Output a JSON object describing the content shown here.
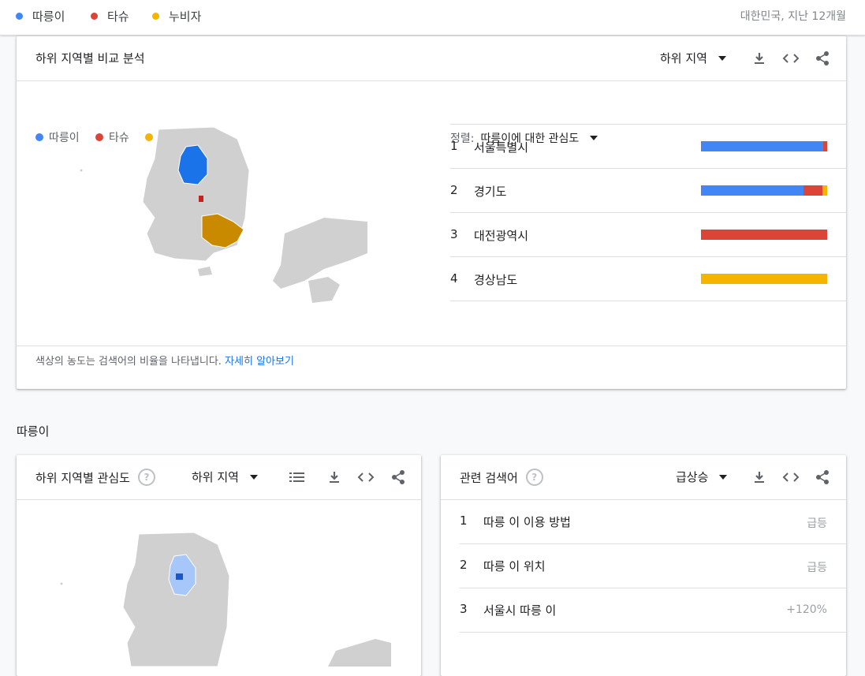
{
  "legend": [
    {
      "label": "따릉이",
      "color": "#4285f4"
    },
    {
      "label": "타슈",
      "color": "#db4437"
    },
    {
      "label": "누비자",
      "color": "#f4b400"
    }
  ],
  "region_note": "대한민국, 지난 12개월",
  "compare_card": {
    "title": "하위 지역별 비교 분석",
    "dropdown": "하위 지역",
    "icons": [
      "download-icon",
      "embed-icon",
      "share-icon"
    ],
    "sort_label": "정렬:",
    "sort_value": "따릉이에 대한 관심도",
    "rows": [
      {
        "rank": "1",
        "name": "서울특별시",
        "shares": [
          0.97,
          0.03,
          0
        ]
      },
      {
        "rank": "2",
        "name": "경기도",
        "shares": [
          0.81,
          0.15,
          0.04
        ]
      },
      {
        "rank": "3",
        "name": "대전광역시",
        "shares": [
          0,
          1,
          0
        ]
      },
      {
        "rank": "4",
        "name": "경상남도",
        "shares": [
          0,
          0,
          1
        ]
      }
    ],
    "note": "색상의 농도는 검색어의 비율을 나타냅니다. ",
    "note_link": "자세히 알아보기"
  },
  "section_title": "따릉이",
  "interest_card": {
    "title": "하위 지역별 관심도",
    "help": "?",
    "dropdown": "하위 지역"
  },
  "related_card": {
    "title": "관련 검색어",
    "help": "?",
    "dropdown": "급상승",
    "rows": [
      {
        "rank": "1",
        "name": "따릉 이 이용 방법",
        "value": "급등"
      },
      {
        "rank": "2",
        "name": "따릉 이 위치",
        "value": "급등"
      },
      {
        "rank": "3",
        "name": "서울시 따릉 이",
        "value": "+120%"
      }
    ]
  }
}
